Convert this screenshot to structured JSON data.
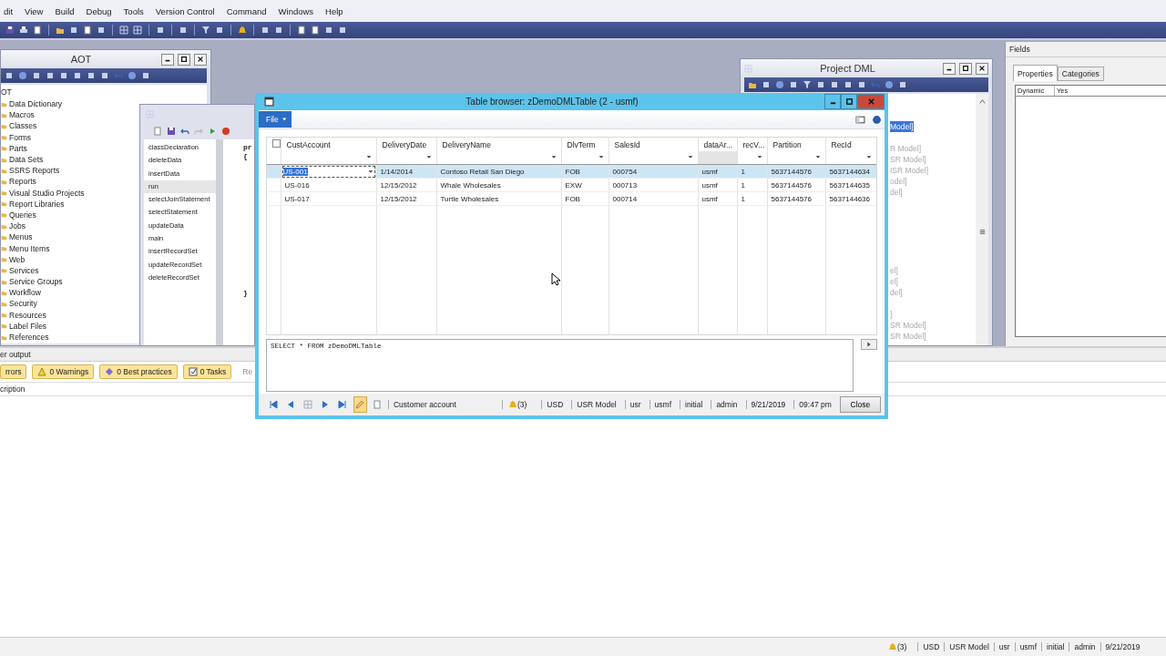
{
  "menu": [
    "dit",
    "View",
    "Build",
    "Debug",
    "Tools",
    "Version Control",
    "Command",
    "Windows",
    "Help"
  ],
  "aot": {
    "title": "AOT",
    "root": "OT",
    "items": [
      "Data Dictionary",
      "Macros",
      "Classes",
      "Forms",
      "Parts",
      "Data Sets",
      "SSRS Reports",
      "Reports",
      "Visual Studio Projects",
      "Report Libraries",
      "Queries",
      "Jobs",
      "Menus",
      "Menu Items",
      "Web",
      "Services",
      "Service Groups",
      "Workflow",
      "Security",
      "Resources",
      "Label Files",
      "References"
    ]
  },
  "class_editor": {
    "methods": [
      {
        "label": "classDeclaration",
        "selected": false
      },
      {
        "label": "deleteData",
        "selected": false
      },
      {
        "label": "insertData",
        "selected": false
      },
      {
        "label": "run",
        "selected": true
      },
      {
        "label": "selectJoinStatement",
        "selected": false
      },
      {
        "label": "selectStatement",
        "selected": false
      },
      {
        "label": "updateData",
        "selected": false
      },
      {
        "label": "main",
        "selected": false
      },
      {
        "label": "insertRecordSet",
        "selected": false
      },
      {
        "label": "updateRecordSet",
        "selected": false
      },
      {
        "label": "deleteRecordSet",
        "selected": false
      }
    ],
    "code_top": [
      "pr",
      "{"
    ],
    "code_end": "}"
  },
  "project": {
    "title": "Project DML",
    "groups": [
      [
        {
          "label": "Model]",
          "selected": true
        }
      ],
      [
        {
          "label": "R Model]",
          "selected": false
        },
        {
          "label": "SR Model]",
          "selected": false
        },
        {
          "label": "ISR Model]",
          "selected": false
        },
        {
          "label": "odel]",
          "selected": false
        },
        {
          "label": "del]",
          "selected": false
        }
      ],
      [
        {
          "label": "el]",
          "selected": false
        },
        {
          "label": "el]",
          "selected": false
        },
        {
          "label": "del]",
          "selected": false
        }
      ],
      [
        {
          "label": "]",
          "selected": false
        },
        {
          "label": "SR Model]",
          "selected": false
        },
        {
          "label": "SR Model]",
          "selected": false
        }
      ]
    ]
  },
  "fields": {
    "title": "Fields",
    "tabs": [
      {
        "label": "Properties",
        "selected": true
      },
      {
        "label": "Categories",
        "selected": false
      }
    ],
    "properties": [
      {
        "name": "Dynamic",
        "value": "Yes"
      }
    ]
  },
  "output": {
    "title": "er output",
    "filters": [
      {
        "kind": "errors",
        "label": "rrors",
        "disabled": false
      },
      {
        "kind": "warnings",
        "label": "0 Warnings",
        "disabled": false
      },
      {
        "kind": "best_practices",
        "label": "0 Best practices",
        "disabled": false
      },
      {
        "kind": "tasks",
        "label": "0 Tasks",
        "disabled": false
      },
      {
        "kind": "other",
        "label": "Re",
        "disabled": true
      }
    ],
    "column": "cription"
  },
  "status_bar": {
    "alerts": "(3)",
    "items": [
      "USD",
      "USR Model",
      "usr",
      "usmf",
      "initial",
      "admin",
      "9/21/2019"
    ]
  },
  "table_browser": {
    "title": "Table browser: zDemoDMLTable (2 - usmf)",
    "file_button": "File",
    "select_all": {
      "checked": false
    },
    "columns": [
      {
        "label": "CustAccount",
        "filter": true
      },
      {
        "label": "DeliveryDate",
        "filter": true
      },
      {
        "label": "DeliveryName",
        "filter": true
      },
      {
        "label": "DlvTerm",
        "filter": true
      },
      {
        "label": "SalesId",
        "filter": true
      },
      {
        "label": "dataAr...",
        "filter": false
      },
      {
        "label": "recV...",
        "filter": true
      },
      {
        "label": "Partition",
        "filter": true
      },
      {
        "label": "RecId",
        "filter": true
      }
    ],
    "rows": [
      {
        "selected": true,
        "cells": [
          "US-001",
          "1/14/2014",
          "Contoso Retail San Diego",
          "FOB",
          "000754",
          "usmf",
          "1",
          "5637144576",
          "5637144634"
        ]
      },
      {
        "selected": false,
        "cells": [
          "US-016",
          "12/15/2012",
          "Whale Wholesales",
          "EXW",
          "000713",
          "usmf",
          "1",
          "5637144576",
          "5637144635"
        ]
      },
      {
        "selected": false,
        "cells": [
          "US-017",
          "12/15/2012",
          "Turtle Wholesales",
          "FOB",
          "000714",
          "usmf",
          "1",
          "5637144576",
          "5637144636"
        ]
      }
    ],
    "query": "SELECT * FROM zDemoDMLTable",
    "status": {
      "edit_mode": true,
      "field": "Customer account",
      "alerts": "(3)",
      "items": [
        "USD",
        "USR Model",
        "usr",
        "usmf",
        "initial",
        "admin",
        "9/21/2019",
        "09:47 pm"
      ]
    },
    "close_button": "Close"
  }
}
